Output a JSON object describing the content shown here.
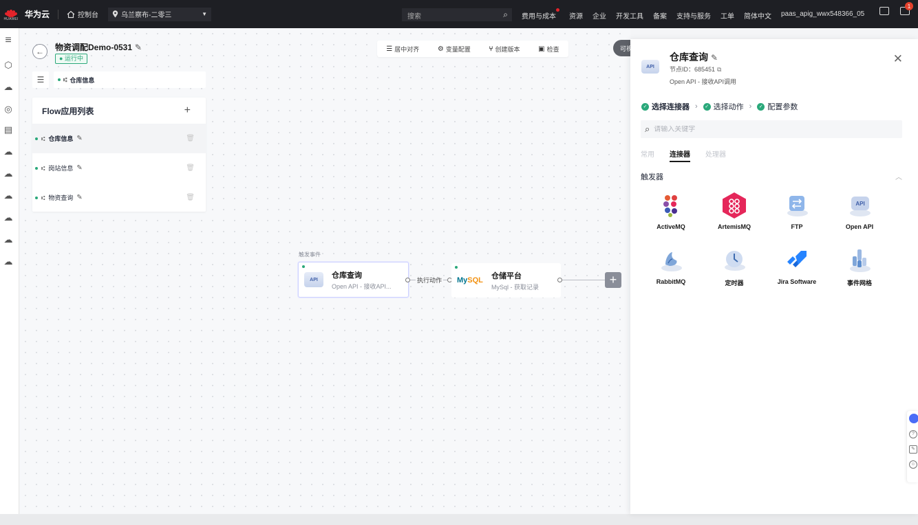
{
  "topbar": {
    "brand_small": "HUAWEI",
    "brand": "华为云",
    "console": "控制台",
    "region": "乌兰察布-二零三",
    "search_placeholder": "搜索",
    "menu": [
      "费用与成本",
      "资源",
      "企业",
      "开发工具",
      "备案",
      "支持与服务",
      "工单",
      "简体中文",
      "paas_apig_wwx548366_05"
    ],
    "notification_count": "1"
  },
  "flow": {
    "title": "物资调配Demo-0531",
    "status": "运行中",
    "breadcrumb": "仓库信息"
  },
  "flow_list": {
    "title": "Flow应用列表",
    "items": [
      {
        "label": "仓库信息"
      },
      {
        "label": "岗站信息"
      },
      {
        "label": "物资查询"
      }
    ]
  },
  "toolbar": {
    "center_align": "居中对齐",
    "variable_config": "变量配置",
    "create_version": "创建版本",
    "check": "检查",
    "more_chip": "可视"
  },
  "canvas": {
    "trigger_label": "触发事件",
    "node1": {
      "title": "仓库查询",
      "subtitle": "Open API - 接收API..."
    },
    "edge_label": "执行动作",
    "node2": {
      "title": "仓储平台",
      "subtitle": "MySql - 获取记录"
    }
  },
  "panel": {
    "title": "仓库查询",
    "node_id": "节点ID：685451",
    "desc": "Open API - 接收API调用",
    "steps": [
      "选择连接器",
      "选择动作",
      "配置参数"
    ],
    "search_placeholder": "请输入关键字",
    "tabs": [
      "常用",
      "连接器",
      "处理器"
    ],
    "section": "触发器",
    "connectors": [
      {
        "name": "ActiveMQ",
        "icon": "activemq-icon"
      },
      {
        "name": "ArtemisMQ",
        "icon": "artemismq-icon"
      },
      {
        "name": "FTP",
        "icon": "ftp-icon"
      },
      {
        "name": "Open API",
        "icon": "open-api-icon"
      },
      {
        "name": "RabbitMQ",
        "icon": "rabbitmq-icon"
      },
      {
        "name": "定时器",
        "icon": "timer-icon"
      },
      {
        "name": "Jira Software",
        "icon": "jira-icon"
      },
      {
        "name": "事件网格",
        "icon": "event-grid-icon"
      }
    ]
  },
  "colors": {
    "topbar": "#1e1f24",
    "accent_green": "#2aa87a",
    "artemis_red": "#e5275a",
    "jira_blue": "#2684ff"
  }
}
